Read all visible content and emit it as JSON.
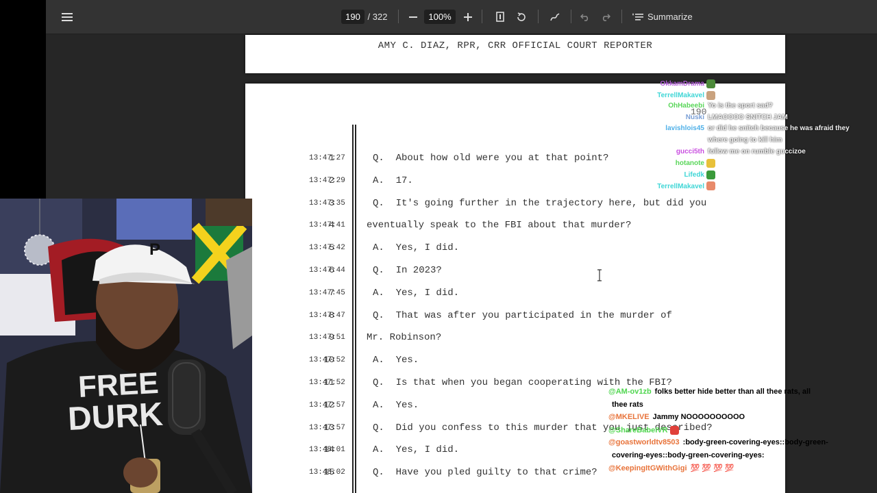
{
  "toolbar": {
    "page_current": "190",
    "page_total": "/ 322",
    "zoom": "100%",
    "summarize_label": "Summarize"
  },
  "document": {
    "reporter_line": "AMY C. DIAZ, RPR, CRR OFFICIAL COURT REPORTER",
    "page_number": "190",
    "lines": [
      {
        "num": "1",
        "time": "13:47:27",
        "text": "Q.  About how old were you at that point?"
      },
      {
        "num": "2",
        "time": "13:47:29",
        "text": "A.  17."
      },
      {
        "num": "3",
        "time": "13:47:35",
        "text": "Q.  It's going further in the trajectory here, but did you"
      },
      {
        "num": "4",
        "time": "13:47:41",
        "text": "eventually speak to the FBI about that murder?"
      },
      {
        "num": "5",
        "time": "13:47:42",
        "text": "A.  Yes, I did."
      },
      {
        "num": "6",
        "time": "13:47:44",
        "text": "Q.  In 2023?"
      },
      {
        "num": "7",
        "time": "13:47:45",
        "text": "A.  Yes, I did."
      },
      {
        "num": "8",
        "time": "13:47:47",
        "text": "Q.  That was after you participated in the murder of"
      },
      {
        "num": "9",
        "time": "13:47:51",
        "text": "Mr. Robinson?"
      },
      {
        "num": "10",
        "time": "13:47:52",
        "text": "A.  Yes."
      },
      {
        "num": "11",
        "time": "13:47:52",
        "text": "Q.  Is that when you began cooperating with the FBI?"
      },
      {
        "num": "12",
        "time": "13:47:57",
        "text": "A.  Yes."
      },
      {
        "num": "13",
        "time": "13:47:57",
        "text": "Q.  Did you confess to this murder that you just described?"
      },
      {
        "num": "14",
        "time": "13:48:01",
        "text": "A.  Yes, I did."
      },
      {
        "num": "15",
        "time": "13:48:02",
        "text": "Q.  Have you pled guilty to that crime?"
      }
    ]
  },
  "webcam": {
    "cap_letter": "P",
    "shirt_line1": "FREE",
    "shirt_line2": "DURK"
  },
  "chat_top": [
    {
      "name": "OkkamDrama",
      "name_color": "#b05bd6",
      "message": "",
      "emote_color": "#4c8a3a"
    },
    {
      "name": "TerrellMakavel",
      "name_color": "#3fd6d6",
      "message": "",
      "emote_color": "#c9a27e"
    },
    {
      "name": "OhHabeebi",
      "name_color": "#59d659",
      "message": "Yo is the sport sad?",
      "emote_color": ""
    },
    {
      "name": "Nuski",
      "name_color": "#7a9fd6",
      "message": "LMAOOOO SNITCH JAM",
      "emote_color": ""
    },
    {
      "name": "lavishlois45",
      "name_color": "#4fb0e8",
      "message": "or did he snitch because he was afraid they",
      "emote_color": ""
    },
    {
      "name": "",
      "name_color": "#4fb0e8",
      "message": "where going to kill him",
      "emote_color": ""
    },
    {
      "name": "gucci5th",
      "name_color": "#c94fe0",
      "message": "follow me on rumble guccizoe",
      "emote_color": ""
    },
    {
      "name": "hotanote",
      "name_color": "#59d659",
      "message": "",
      "emote_color": "#e8c13a"
    },
    {
      "name": "Lifedk",
      "name_color": "#3fd6d6",
      "message": "",
      "emote_color": "#3a9a3a"
    },
    {
      "name": "TerrellMakavel",
      "name_color": "#3fd6d6",
      "message": "",
      "emote_color": "#e88a6a"
    }
  ],
  "chat_bottom": [
    {
      "name": "@AM-ov1zb",
      "name_color": "#4fd64f",
      "message": "folks better hide better than all thee rats, all",
      "emote_color": ""
    },
    {
      "name": "",
      "name_color": "#4fd64f",
      "message": "thee rats",
      "emote_color": ""
    },
    {
      "name": "@MKELIVE",
      "name_color": "#e8733a",
      "message": "Jammy NOOOOOOOOOO",
      "emote_color": ""
    },
    {
      "name": "@ShareBabeIVR",
      "name_color": "#4fd64f",
      "message": "",
      "emote_color": "#e0403a"
    },
    {
      "name": "@goastworldtv8503",
      "name_color": "#e8733a",
      "message": ":body-green-covering-eyes::body-green-",
      "emote_color": ""
    },
    {
      "name": "",
      "name_color": "#e8733a",
      "message": "covering-eyes::body-green-covering-eyes:",
      "emote_color": ""
    },
    {
      "name": "@KeepingItGWithGigi",
      "name_color": "#e8733a",
      "message": "💯 💯 💯 💯",
      "emote_color": ""
    }
  ],
  "colors": {
    "toolbar_bg": "#333333",
    "viewer_bg": "#262626",
    "page_bg": "#ffffff"
  }
}
